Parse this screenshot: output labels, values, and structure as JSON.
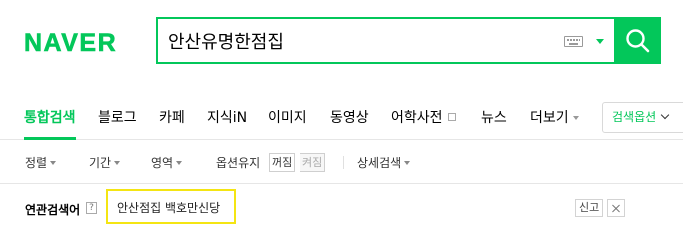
{
  "header": {
    "logo": "NAVER",
    "search": {
      "value": "안산유명한점집",
      "icons": [
        "keyboard-icon",
        "dropdown-arrow-icon",
        "search-icon"
      ]
    },
    "accent_color": "#03c75a"
  },
  "tabs": {
    "items": [
      {
        "label": "통합검색",
        "active": true
      },
      {
        "label": "블로그"
      },
      {
        "label": "카페"
      },
      {
        "label": "지식iN"
      },
      {
        "label": "이미지"
      },
      {
        "label": "동영상"
      },
      {
        "label": "어학사전"
      },
      {
        "label": "뉴스"
      },
      {
        "label": "더보기"
      }
    ],
    "options_label": "검색옵션"
  },
  "filters": {
    "items": [
      "정렬",
      "기간",
      "영역",
      "옵션유지"
    ],
    "toggle_on": "꺼짐",
    "toggle_off": "켜짐",
    "detail": "상세검색"
  },
  "related": {
    "title": "연관검색어",
    "help": "?",
    "terms": [
      "안산점집 백호만신당"
    ],
    "report_label": "신고",
    "highlight_color": "#f4e513"
  }
}
